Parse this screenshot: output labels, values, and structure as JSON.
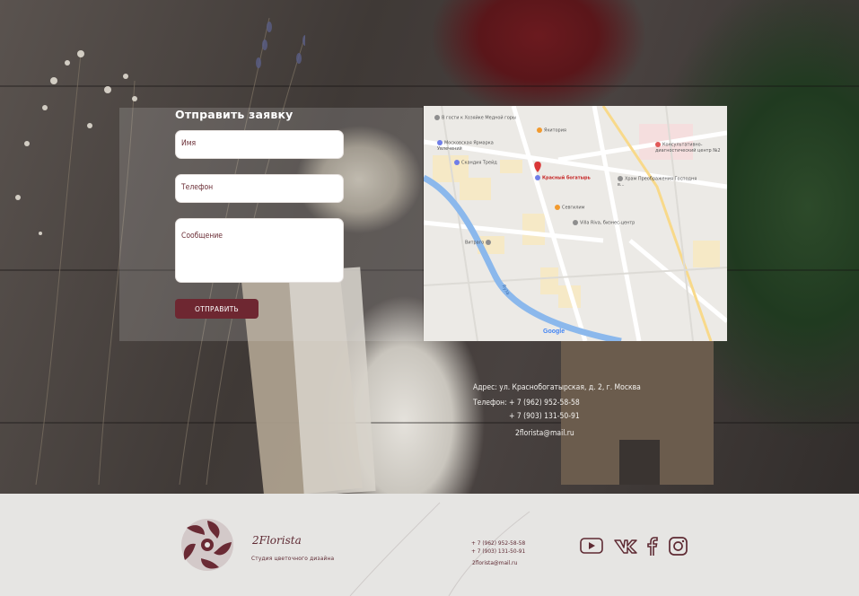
{
  "form": {
    "title": "Отправить заявку",
    "name_label": "Имя",
    "phone_label": "Телефон",
    "message_label": "Сообщение",
    "submit_label": "ОТПРАВИТЬ"
  },
  "map": {
    "pois": [
      "В гости к Хозяйке Медной горы",
      "Якитория",
      "Московская Ярмарка Увлечений",
      "Консультативно-диагностический центр №2",
      "Скандия Трейд",
      "Красный богатырь",
      "Храм Преображения Господня в...",
      "Севгилим",
      "Villa Riva, бизнес-центр",
      "Витраго"
    ],
    "river_label": "Яуза",
    "google_label": "Google"
  },
  "contacts": {
    "address": "Адрес: ул. Краснобогатырская, д. 2, г. Москва",
    "phone_prefix": "Телефон:",
    "phone1": "+ 7 (962) 952-58-58",
    "phone2": "+ 7 (903) 131-50-91",
    "email": "2florista@mail.ru"
  },
  "footer": {
    "brand": "2Florista",
    "tagline": "Студия цветочного дизайна",
    "phone1": "+ 7 (962) 952-58-58",
    "phone2": "+ 7 (903) 131-50-91",
    "email": "2florista@mail.ru",
    "social": [
      "youtube-icon",
      "vk-icon",
      "facebook-icon",
      "instagram-icon"
    ]
  },
  "colors": {
    "accent": "#6e2731",
    "brand": "#5e2a33",
    "footer_bg": "#e6e5e3"
  }
}
